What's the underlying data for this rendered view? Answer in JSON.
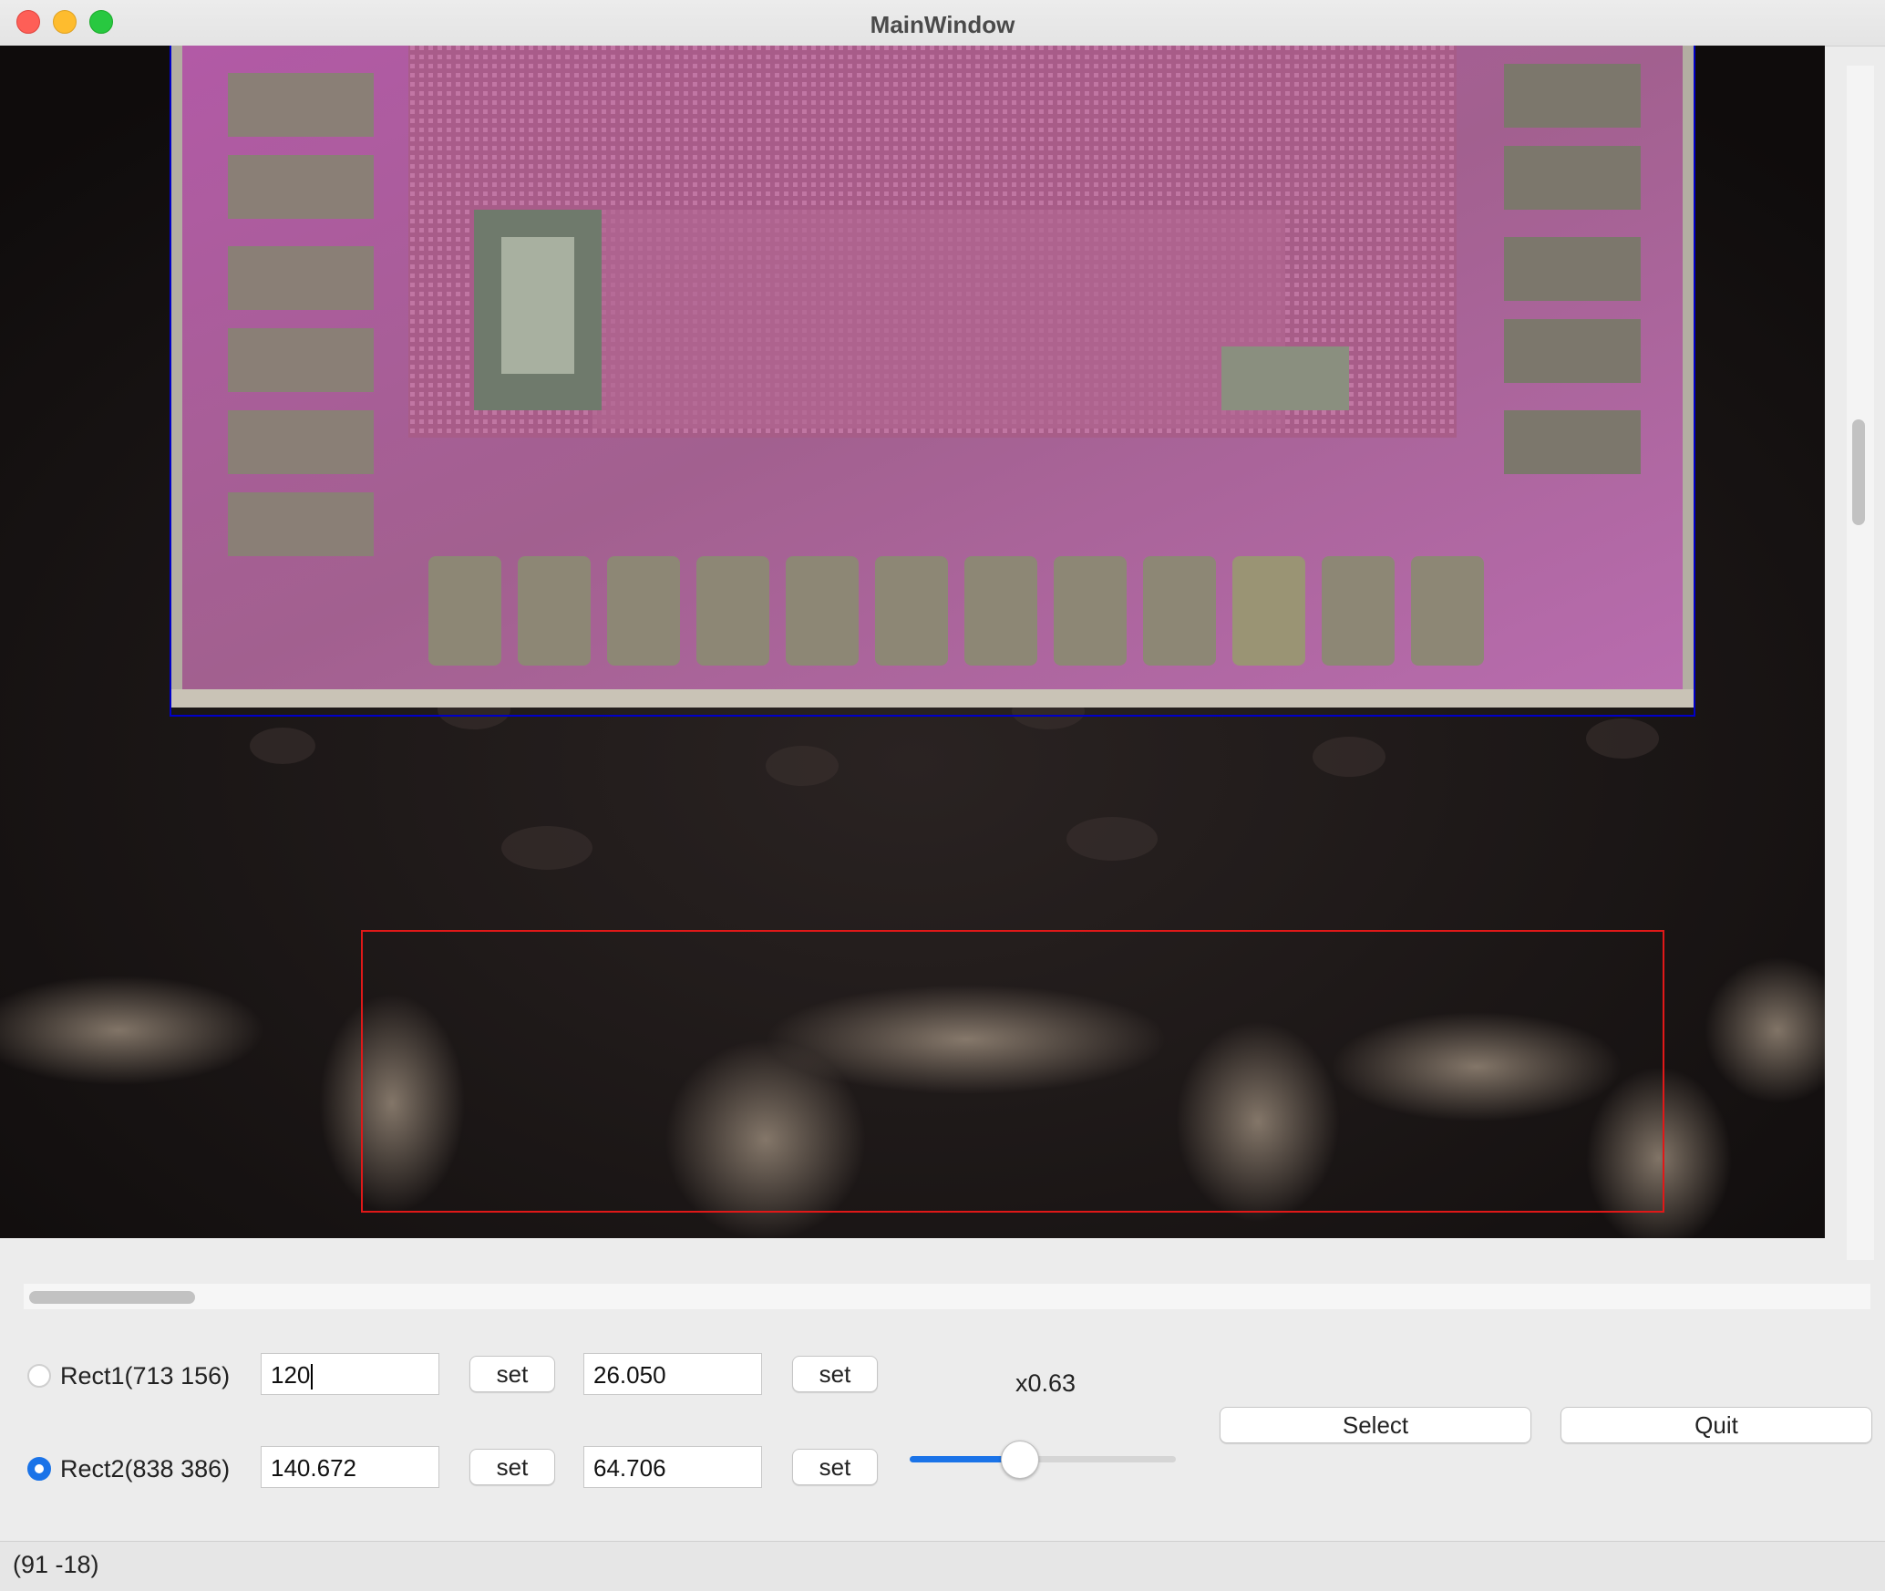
{
  "window": {
    "title": "MainWindow"
  },
  "viewport": {
    "image_description_icon": "chip-die-micrograph-image",
    "rect1_color": "#0000c8",
    "rect2_color": "#e01818"
  },
  "controls": {
    "rect1": {
      "label": "Rect1(713 156)",
      "selected": false,
      "value1": "120",
      "value2": "26.050",
      "set_label": "set"
    },
    "rect2": {
      "label": "Rect2(838 386)",
      "selected": true,
      "value1": "140.672",
      "value2": "64.706",
      "set_label": "set"
    },
    "zoom": {
      "label": "x0.63",
      "level": 0.41
    },
    "select_label": "Select",
    "quit_label": "Quit"
  },
  "status": {
    "coordinates": "(91 -18)"
  },
  "colors": {
    "accent": "#1a73e8"
  }
}
